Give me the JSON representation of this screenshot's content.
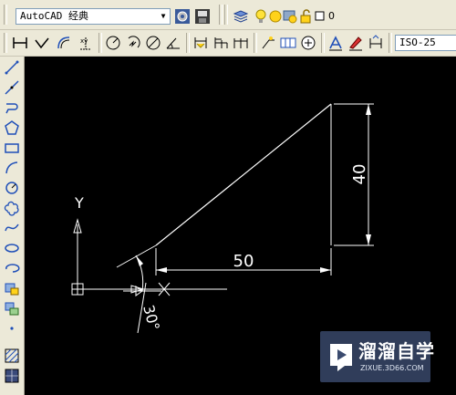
{
  "toolbar": {
    "workspace_select": "AutoCAD 经典",
    "layer_value": "0",
    "dimstyle_select": "ISO-25"
  },
  "drawing": {
    "dim_horizontal": "50",
    "dim_vertical": "40",
    "dim_angle": "30°",
    "ucs_y_label": "Y",
    "ucs_x_label": "X"
  },
  "watermark": {
    "brand": "溜溜自学",
    "url": "ZIXUE.3D66.COM"
  },
  "colors": {
    "canvas": "#000000",
    "geometry": "#ffffff",
    "toolbar_bg": "#ece9d8",
    "icon_blue": "#1f4fb8"
  }
}
